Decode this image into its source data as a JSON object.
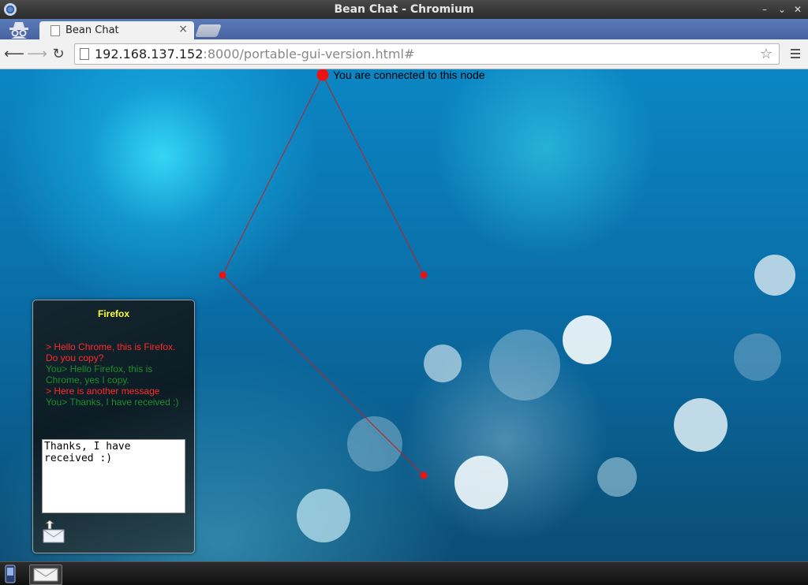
{
  "window": {
    "title": "Bean Chat - Chromium",
    "controls": [
      "–",
      "⌄",
      "✕"
    ]
  },
  "browser": {
    "tab_title": "Bean Chat",
    "tab_close": "×",
    "url_host": "192.168.137.152",
    "url_rest": ":8000/portable-gui-version.html#",
    "icons": [
      "back-icon",
      "forward-icon",
      "reload-icon",
      "bookmark-star-icon",
      "menu-icon",
      "incognito-icon"
    ]
  },
  "page": {
    "connected_label": "You are connected to this node",
    "colors": {
      "node": "#ee1111",
      "edge": "#c0201f",
      "chat_title": "#ffff33",
      "incoming": "#ff2a2a",
      "outgoing": "#1e8e2a"
    }
  },
  "chat": {
    "title": "Firefox",
    "messages": [
      {
        "dir": "in",
        "text": "> Hello Chrome, this is Firefox. Do you copy?"
      },
      {
        "dir": "out",
        "text": "You> Hello Firefox, this is Chrome, yes I copy."
      },
      {
        "dir": "in",
        "text": "> Here is another message"
      },
      {
        "dir": "out",
        "text": "You> Thanks, I have received :)"
      }
    ],
    "input_value": "Thanks, I have received :)"
  },
  "taskbar": {
    "items": [
      "phone-icon",
      "mail-icon"
    ]
  }
}
